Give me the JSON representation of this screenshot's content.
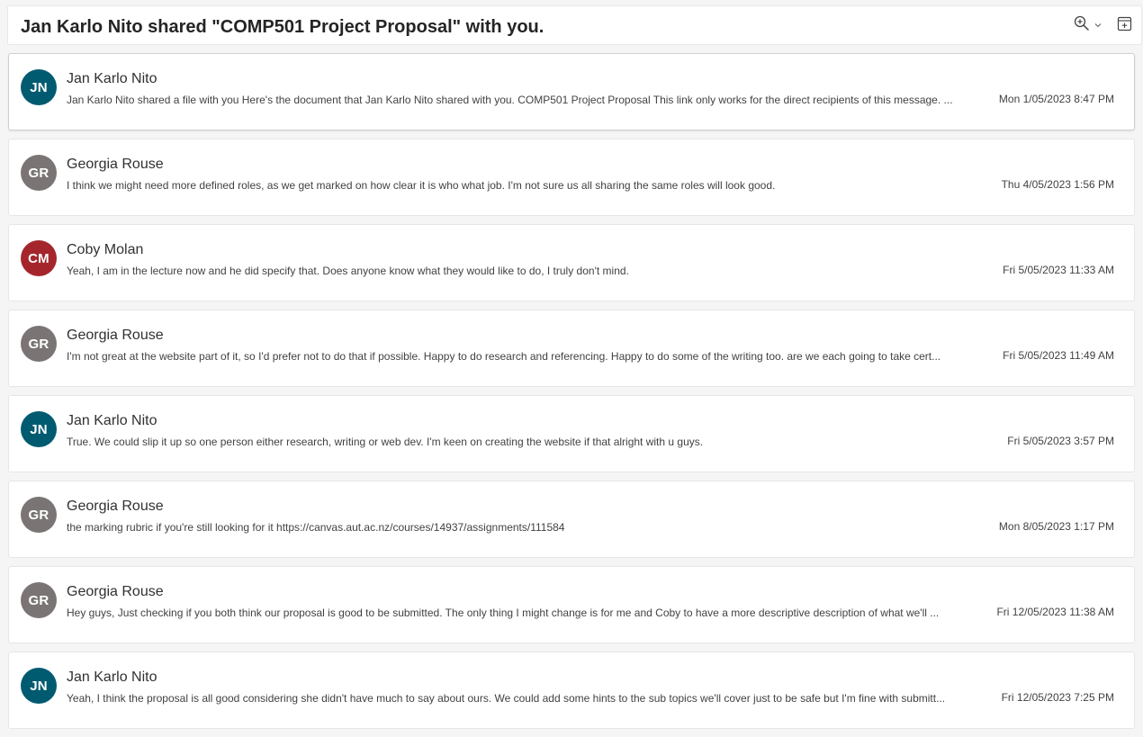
{
  "thread": {
    "title": "Jan Karlo Nito shared \"COMP501 Project Proposal\" with you."
  },
  "toolbar": {
    "zoom_icon": "zoom-in-icon",
    "dropdown_icon": "chevron-down-icon",
    "expand_icon": "open-in-new-window-icon"
  },
  "colors": {
    "jn": "#005b70",
    "gr": "#7a7574",
    "cm": "#a4262c"
  },
  "messages": [
    {
      "initials": "JN",
      "sender": "Jan Karlo Nito",
      "preview": "Jan Karlo Nito shared a file with you Here's the document that Jan Karlo Nito shared with you. COMP501 Project Proposal This link only works for the direct recipients of this message. ...",
      "date": "Mon 1/05/2023 8:47 PM",
      "color": "#005b70"
    },
    {
      "initials": "GR",
      "sender": "Georgia Rouse",
      "preview": "I think we might need more defined roles, as we get marked on how clear it is who what job. I'm not sure us all sharing the same roles will look good.",
      "date": "Thu 4/05/2023 1:56 PM",
      "color": "#7a7574"
    },
    {
      "initials": "CM",
      "sender": "Coby Molan",
      "preview": "Yeah, I am in the lecture now and he did specify that. Does anyone know what they would like to do, I truly don't mind.",
      "date": "Fri 5/05/2023 11:33 AM",
      "color": "#a4262c"
    },
    {
      "initials": "GR",
      "sender": "Georgia Rouse",
      "preview": "I'm not great at the website part of it, so I'd prefer not to do that if possible. Happy to do research and referencing. Happy to do some of the writing too. are we each going to take cert...",
      "date": "Fri 5/05/2023 11:49 AM",
      "color": "#7a7574"
    },
    {
      "initials": "JN",
      "sender": "Jan Karlo Nito",
      "preview": "True. We could slip it up so one person either research, writing or web dev. I'm keen on creating the website if that alright with u guys.",
      "date": "Fri 5/05/2023 3:57 PM",
      "color": "#005b70"
    },
    {
      "initials": "GR",
      "sender": "Georgia Rouse",
      "preview": "the marking rubric if you're still looking for it https://canvas.aut.ac.nz/courses/14937/assignments/111584",
      "date": "Mon 8/05/2023 1:17 PM",
      "color": "#7a7574"
    },
    {
      "initials": "GR",
      "sender": "Georgia Rouse",
      "preview": "Hey guys, Just checking if you both think our proposal is good to be submitted. The only thing I might change is for me and Coby to have a more descriptive description of what we'll ...",
      "date": "Fri 12/05/2023 11:38 AM",
      "color": "#7a7574"
    },
    {
      "initials": "JN",
      "sender": "Jan Karlo Nito",
      "preview": "Yeah, I think the proposal is all good considering she didn't have much to say about ours. We could add some hints to the sub topics we'll cover just to be safe but I'm fine with submitt...",
      "date": "Fri 12/05/2023 7:25 PM",
      "color": "#005b70"
    }
  ]
}
